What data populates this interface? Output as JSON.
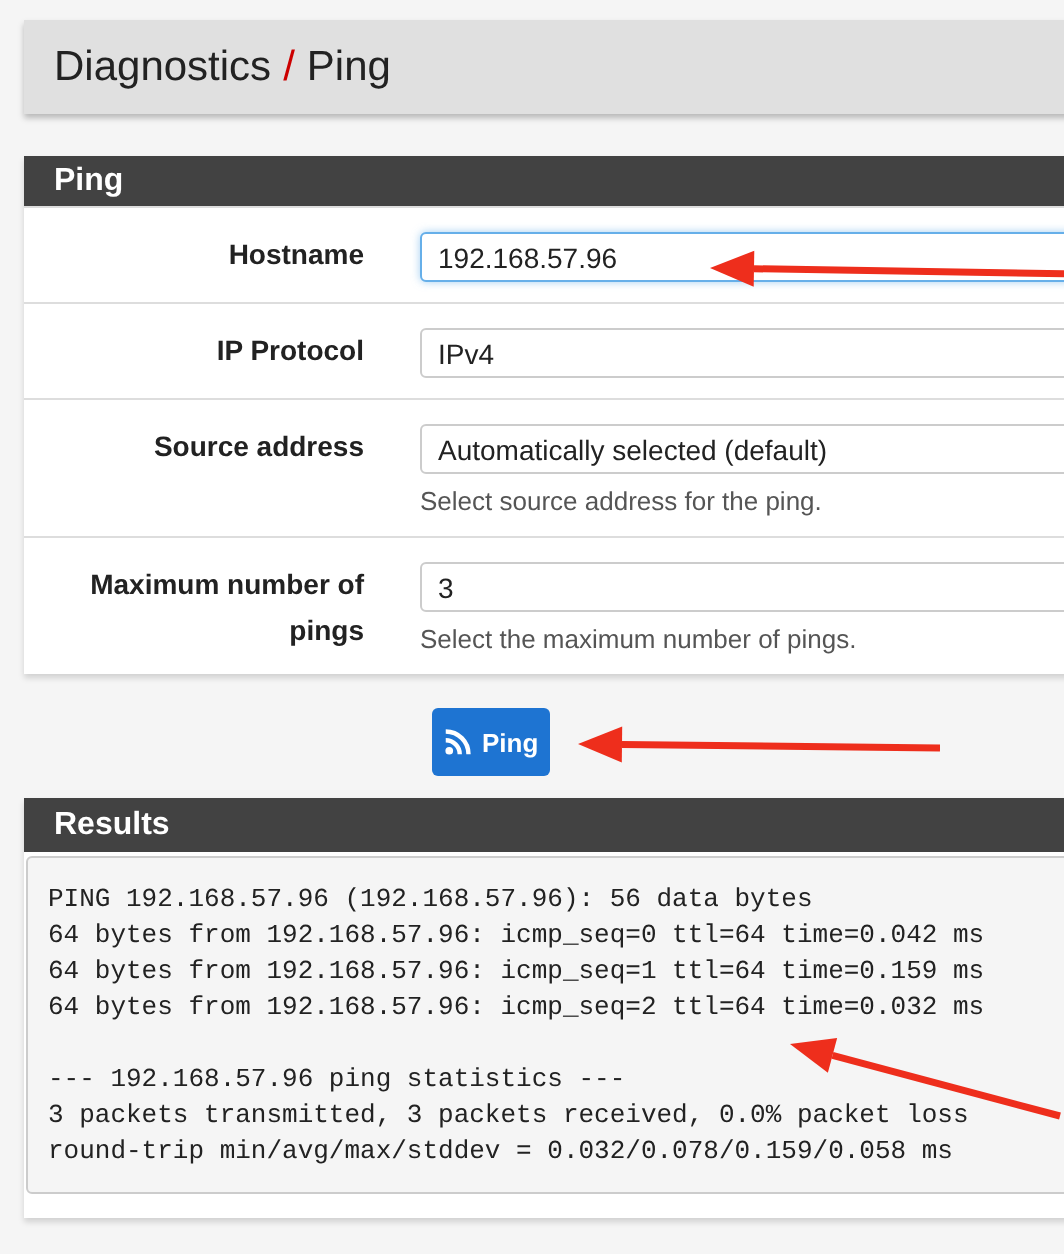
{
  "breadcrumb": {
    "section": "Diagnostics",
    "separator": "/",
    "page": "Ping"
  },
  "form": {
    "title": "Ping",
    "fields": [
      {
        "label": "Hostname",
        "value": "192.168.57.96",
        "focused": true
      },
      {
        "label": "IP Protocol",
        "value": "IPv4",
        "focused": false
      },
      {
        "label": "Source address",
        "value": "Automatically selected (default)",
        "help": "Select source address for the ping.",
        "focused": false
      },
      {
        "label": "Maximum number of pings",
        "value": "3",
        "help": "Select the maximum number of pings.",
        "focused": false
      }
    ]
  },
  "action_button": {
    "label": "Ping"
  },
  "results": {
    "title": "Results",
    "blocks": [
      [
        "PING 192.168.57.96 (192.168.57.96): 56 data bytes",
        "64 bytes from 192.168.57.96: icmp_seq=0 ttl=64 time=0.042 ms",
        "64 bytes from 192.168.57.96: icmp_seq=1 ttl=64 time=0.159 ms",
        "64 bytes from 192.168.57.96: icmp_seq=2 ttl=64 time=0.032 ms"
      ],
      [
        "--- 192.168.57.96 ping statistics ---",
        "3 packets transmitted, 3 packets received, 0.0% packet loss",
        "round-trip min/avg/max/stddev = 0.032/0.078/0.159/0.058 ms"
      ]
    ]
  }
}
